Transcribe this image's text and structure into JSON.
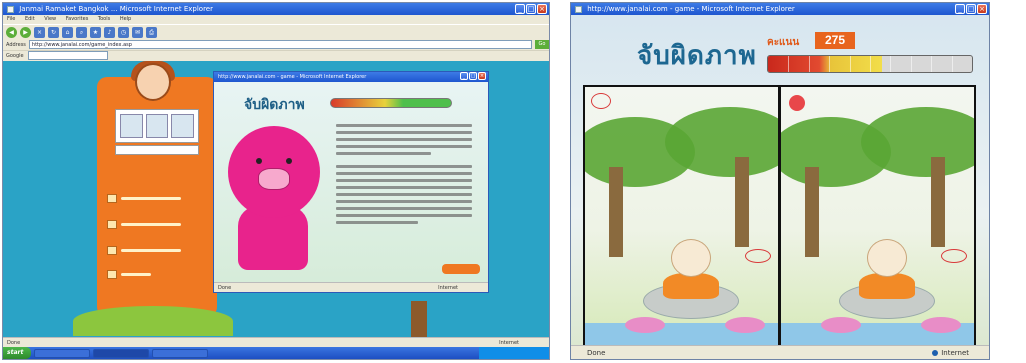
{
  "left_screenshot": {
    "browser": {
      "title": "Janmai Ramaket Bangkok ... Microsoft Internet Explorer",
      "menu": [
        "File",
        "Edit",
        "View",
        "Favorites",
        "Tools",
        "Help"
      ],
      "address_label": "Address",
      "address_value": "http://www.janalai.com/game_index.asp",
      "go_label": "Go",
      "google_label": "Google"
    },
    "popup": {
      "title": "http://www.janalai.com - game - Microsoft Internet Explorer",
      "game_title": "จับผิดภาพ",
      "status": "Done",
      "zone": "Internet"
    },
    "status": "Done",
    "zone": "Internet",
    "taskbar": {
      "start_label": "start",
      "items": [
        "",
        "",
        "",
        ""
      ]
    }
  },
  "right_screenshot": {
    "window_title": "http://www.janalai.com - game - Microsoft Internet Explorer",
    "game_title": "จับผิดภาพ",
    "score_label": "คะแนน",
    "score_value": "275",
    "progress_fraction": 0.56,
    "progress_segments": 10,
    "status": "Done",
    "zone": "Internet",
    "colors": {
      "score_box": "#e8641d",
      "title": "#1d6791",
      "found_marker": "#d93a3a"
    }
  }
}
